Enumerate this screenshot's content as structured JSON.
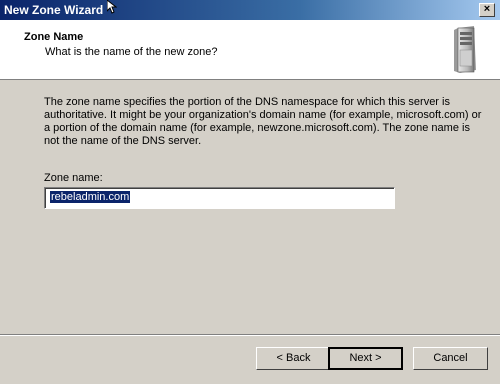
{
  "window": {
    "title": "New Zone Wizard",
    "close_label": "×"
  },
  "header": {
    "title": "Zone Name",
    "subtitle": "What is the name of the new zone?",
    "icon": "server-icon"
  },
  "body": {
    "description": "The zone name specifies the portion of the DNS namespace for which this server is authoritative. It might be your organization's domain name (for example,  microsoft.com) or a portion of the domain name (for example, newzone.microsoft.com). The zone name is not the name of the DNS server.",
    "zone_name_label": "Zone name:",
    "zone_name_value": "rebeladmin.com"
  },
  "buttons": {
    "back": "< Back",
    "next": "Next >",
    "cancel": "Cancel"
  }
}
